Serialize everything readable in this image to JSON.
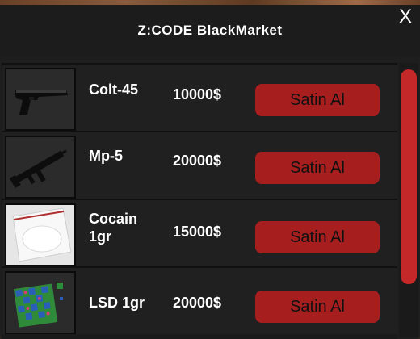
{
  "window": {
    "title": "Z:CODE BlackMarket",
    "close_label": "X"
  },
  "items": [
    {
      "name": "Colt-45",
      "price": "10000$",
      "buy_label": "Satin Al",
      "image": "pistol-icon"
    },
    {
      "name": "Mp-5",
      "price": "20000$",
      "buy_label": "Satin Al",
      "image": "smg-icon"
    },
    {
      "name": "Cocain\n1gr",
      "price": "15000$",
      "buy_label": "Satin Al",
      "image": "powder-bag-icon"
    },
    {
      "name": "LSD 1gr",
      "price": "20000$",
      "buy_label": "Satin Al",
      "image": "blotter-paper-icon"
    }
  ],
  "scroll": {
    "position": 0.0,
    "visible_fraction": 0.78
  },
  "colors": {
    "button": "#a61e1e",
    "scrollbar": "#c42828",
    "panel": "#1e1e1e"
  }
}
